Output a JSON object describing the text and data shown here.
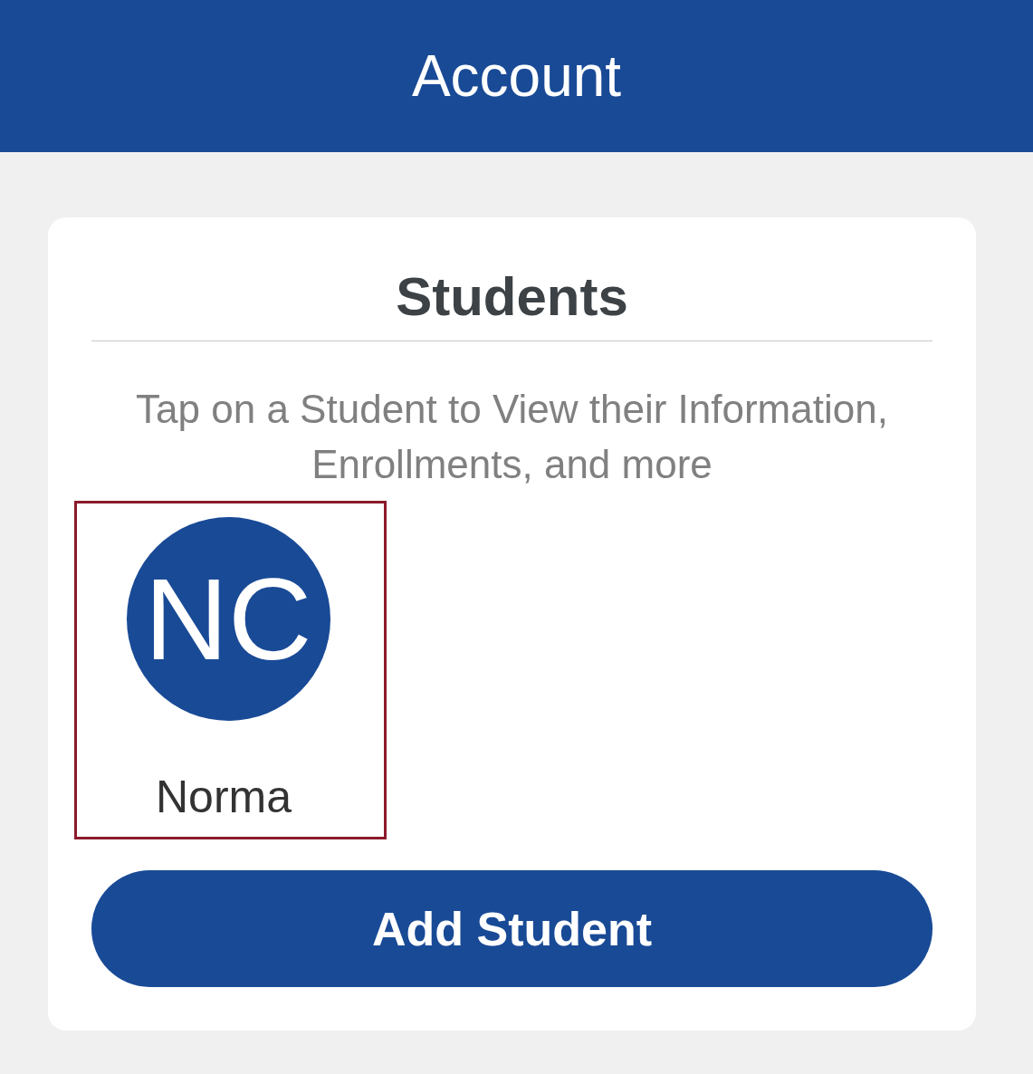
{
  "header": {
    "title": "Account"
  },
  "card": {
    "title": "Students",
    "hint": "Tap on a Student to View their Information, Enrollments, and more",
    "students": [
      {
        "initials": "NC",
        "name": "Norma",
        "selected": true
      }
    ],
    "button": "Add Student"
  }
}
